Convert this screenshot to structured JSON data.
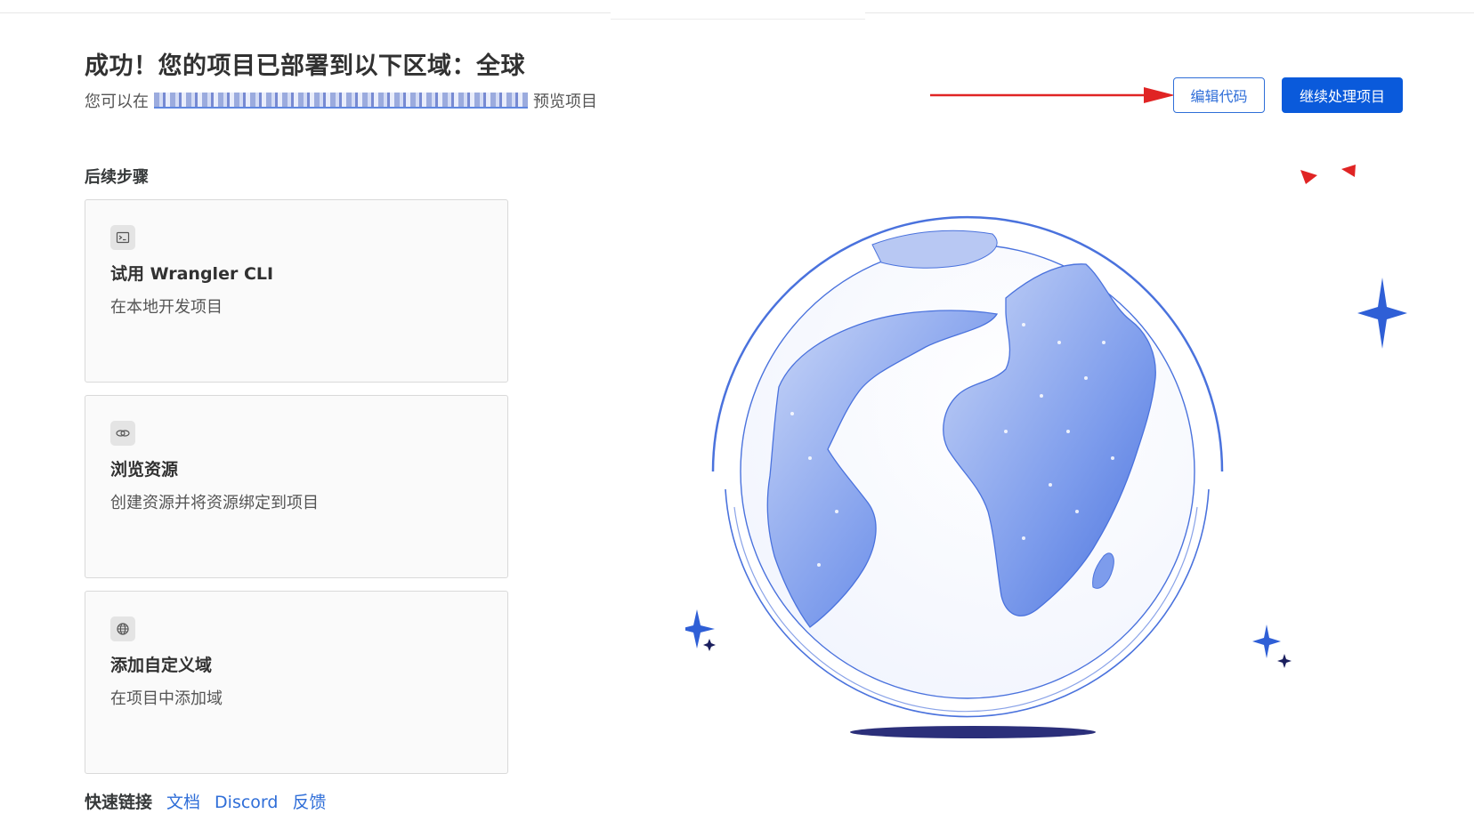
{
  "header": {
    "title": "成功！您的项目已部署到以下区域：全球",
    "preview_prefix": "您可以在",
    "preview_suffix": "预览项目",
    "edit_code_label": "编辑代码",
    "continue_label": "继续处理项目"
  },
  "next_steps": {
    "heading": "后续步骤",
    "cards": [
      {
        "icon": "terminal-icon",
        "title": "试用 Wrangler CLI",
        "description": "在本地开发项目"
      },
      {
        "icon": "link-icon",
        "title": "浏览资源",
        "description": "创建资源并将资源绑定到项目"
      },
      {
        "icon": "globe-icon",
        "title": "添加自定义域",
        "description": "在项目中添加域"
      }
    ]
  },
  "quick_links": {
    "label": "快速链接",
    "items": [
      "文档",
      "Discord",
      "反馈"
    ]
  },
  "colors": {
    "accent": "#0a5adb",
    "annotation_red": "#e02424",
    "globe_blue": "#4a72dd",
    "sparkle_dark": "#1b1f5e"
  }
}
